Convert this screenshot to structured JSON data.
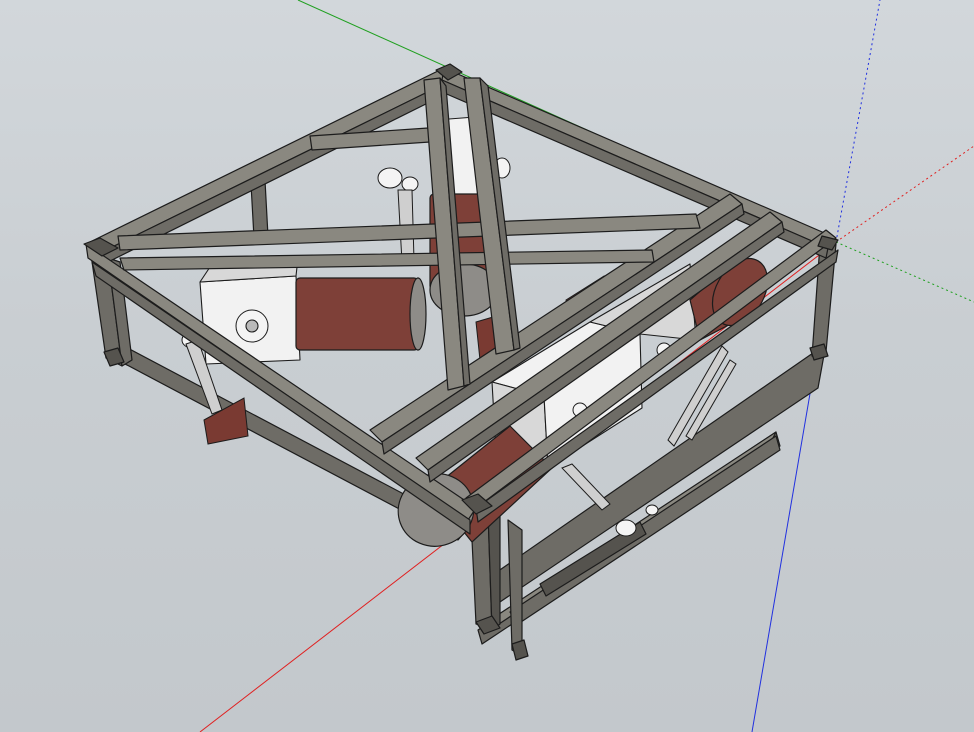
{
  "scene": {
    "background_color": "#cbd0d4",
    "beam_color": "#6e6c66",
    "motor_color": "#7e4038",
    "housing_color": "#e6e6e6"
  },
  "axes": {
    "x_axis_color": "#e02020",
    "y_axis_color": "#20a020",
    "z_axis_color": "#2030e0",
    "axis_icon": "3d-axes-icon"
  }
}
